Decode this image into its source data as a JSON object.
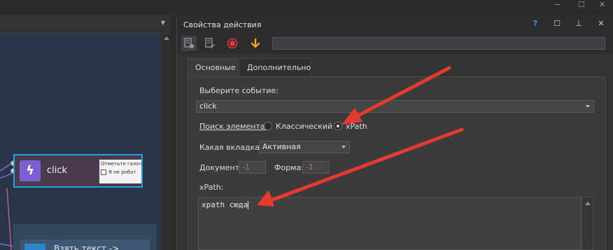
{
  "canvas": {
    "node_click": {
      "label": "click",
      "icon": "lightning-icon"
    },
    "captcha": {
      "line1": "Отметьте галоч",
      "line2": "Я не робот"
    },
    "node_next": {
      "label": "Взять текст ->"
    }
  },
  "dialog": {
    "title": "Свойства действия",
    "title_buttons": {
      "help": "?",
      "maximize": "☐",
      "pin": "⊥",
      "close": "✕"
    },
    "tabs": [
      "Основные",
      "Дополнительно"
    ],
    "event_label": "Выберите событие:",
    "event_value": "click",
    "search_label": "Поиск элемента:",
    "search_option_classic": "Классический",
    "search_option_xpath": "xPath",
    "tab_label": "Какая вкладка:",
    "tab_value": "Активная",
    "document_label": "Документ:",
    "document_value": "-1",
    "form_label": "Форма:",
    "form_value": "-1",
    "xpath_label": "xPath:",
    "xpath_value": "xpath сюда"
  },
  "colors": {
    "accent_blue": "#2a9fd8",
    "annotation_red": "#e53a2f",
    "record_red": "#e53935",
    "download_orange": "#f0a81c"
  }
}
